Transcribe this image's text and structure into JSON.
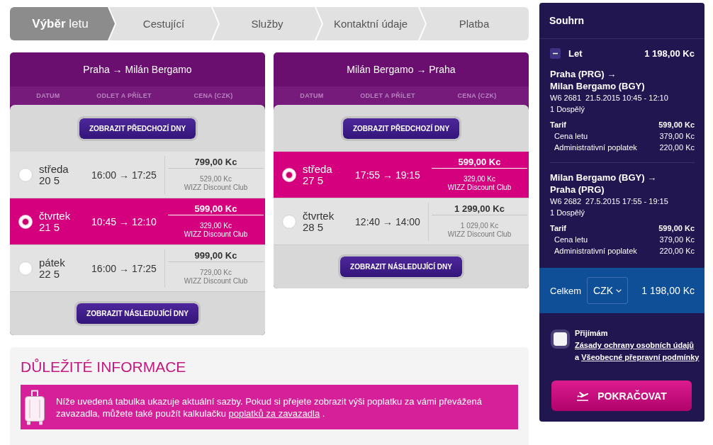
{
  "steps": [
    {
      "label": "**Výběr** letu",
      "selected": true
    },
    {
      "label": "Cestující",
      "selected": false
    },
    {
      "label": "Služby",
      "selected": false
    },
    {
      "label": "Kontaktní údaje",
      "selected": false
    },
    {
      "label": "Platba",
      "selected": false
    }
  ],
  "flights": [
    {
      "title": "Praha → Milán Bergamo",
      "columns": [
        "DATUM",
        "ODLET A PŘÍLET",
        "CENA (CZK)"
      ],
      "previous_days_button": "ZOBRAZIT PŘEDCHOZÍ DNY",
      "rows": [
        {
          "day": "středa",
          "date": "20 5",
          "times": "16:00 → 17:25",
          "price": "799,00 Kc",
          "club_price": "529,00 Kc",
          "club_label": "WIZZ Discount Club",
          "selected": false
        },
        {
          "day": "čtvrtek",
          "date": "21 5",
          "times": "10:45 → 12:10",
          "price": "599,00 Kc",
          "club_price": "329,00 Kc",
          "club_label": "WIZZ Discount Club",
          "selected": true
        },
        {
          "day": "pátek",
          "date": "22 5",
          "times": "16:00 → 17:25",
          "price": "999,00 Kc",
          "club_price": "729,00 Kc",
          "club_label": "WIZZ Discount Club",
          "selected": false
        }
      ],
      "next_days_button": "ZOBRAZIT NÁSLEDUJÍCÍ DNY"
    },
    {
      "title": "Milán Bergamo → Praha",
      "columns": [
        "DATUM",
        "ODLET A PŘÍLET",
        "CENA (CZK)"
      ],
      "previous_days_button": "ZOBRAZIT PŘEDCHOZÍ DNY",
      "rows": [
        {
          "day": "středa",
          "date": "27 5",
          "times": "17:55 → 19:15",
          "price": "599,00 Kc",
          "club_price": "329,00 Kc",
          "club_label": "WIZZ Discount Club",
          "selected": true
        },
        {
          "day": "čtvrtek",
          "date": "28 5",
          "times": "12:40 → 14:00",
          "price": "1 299,00 Kc",
          "club_price": "1 029,00 Kc",
          "club_label": "WIZZ Discount Club",
          "selected": false
        }
      ],
      "next_days_button": "ZOBRAZIT NÁSLEDUJÍCÍ DNY"
    }
  ],
  "important_info": {
    "title": "DŮLEŽITÉ INFORMACE",
    "text": "Níže uvedená tabulka ukazuje aktuální sazby. Pokud si přejete zobrazit výši poplatku za vámi převážená zavazadla, můžete také použít kalkulačku",
    "link": "poplatků za zavazadla",
    "text_end": "."
  },
  "summary": {
    "title": "Souhrn",
    "section": {
      "label": "Let",
      "amount": "1 198,00 Kc",
      "expanded": true
    },
    "legs": [
      {
        "route": [
          "Praha (PRG) →",
          "Milan Bergamo (BGY)"
        ],
        "flight_number": "W6 2681",
        "schedule": "21.5.2015 10:45 - 12:10",
        "passengers": "1 Dospělý",
        "fare": {
          "label": "Tarif",
          "amount": "599,00 Kc"
        },
        "items": [
          {
            "label": "Cena letu",
            "amount": "379,00 Kc"
          },
          {
            "label": "Administrativní poplatek",
            "amount": "220,00 Kc"
          }
        ]
      },
      {
        "route": [
          "Milan Bergamo (BGY) →",
          "Praha (PRG)"
        ],
        "flight_number": "W6 2682",
        "schedule": "27.5.2015 17:55 - 19:15",
        "passengers": "1 Dospělý",
        "fare": {
          "label": "Tarif",
          "amount": "599,00 Kc"
        },
        "items": [
          {
            "label": "Cena letu",
            "amount": "379,00 Kc"
          },
          {
            "label": "Administrativní poplatek",
            "amount": "220,00 Kc"
          }
        ]
      }
    ],
    "total": {
      "label": "Celkem",
      "currency": "CZK",
      "amount": "1 198,00 Kc"
    },
    "consent": {
      "checked": false,
      "text": "Přijímám",
      "privacy_link": "Zásady ochrany osobních údajů",
      "conjunction": "a",
      "terms_link": "Všeobecné přepravní podmínky"
    },
    "continue_button": "POKRAČOVAT"
  }
}
